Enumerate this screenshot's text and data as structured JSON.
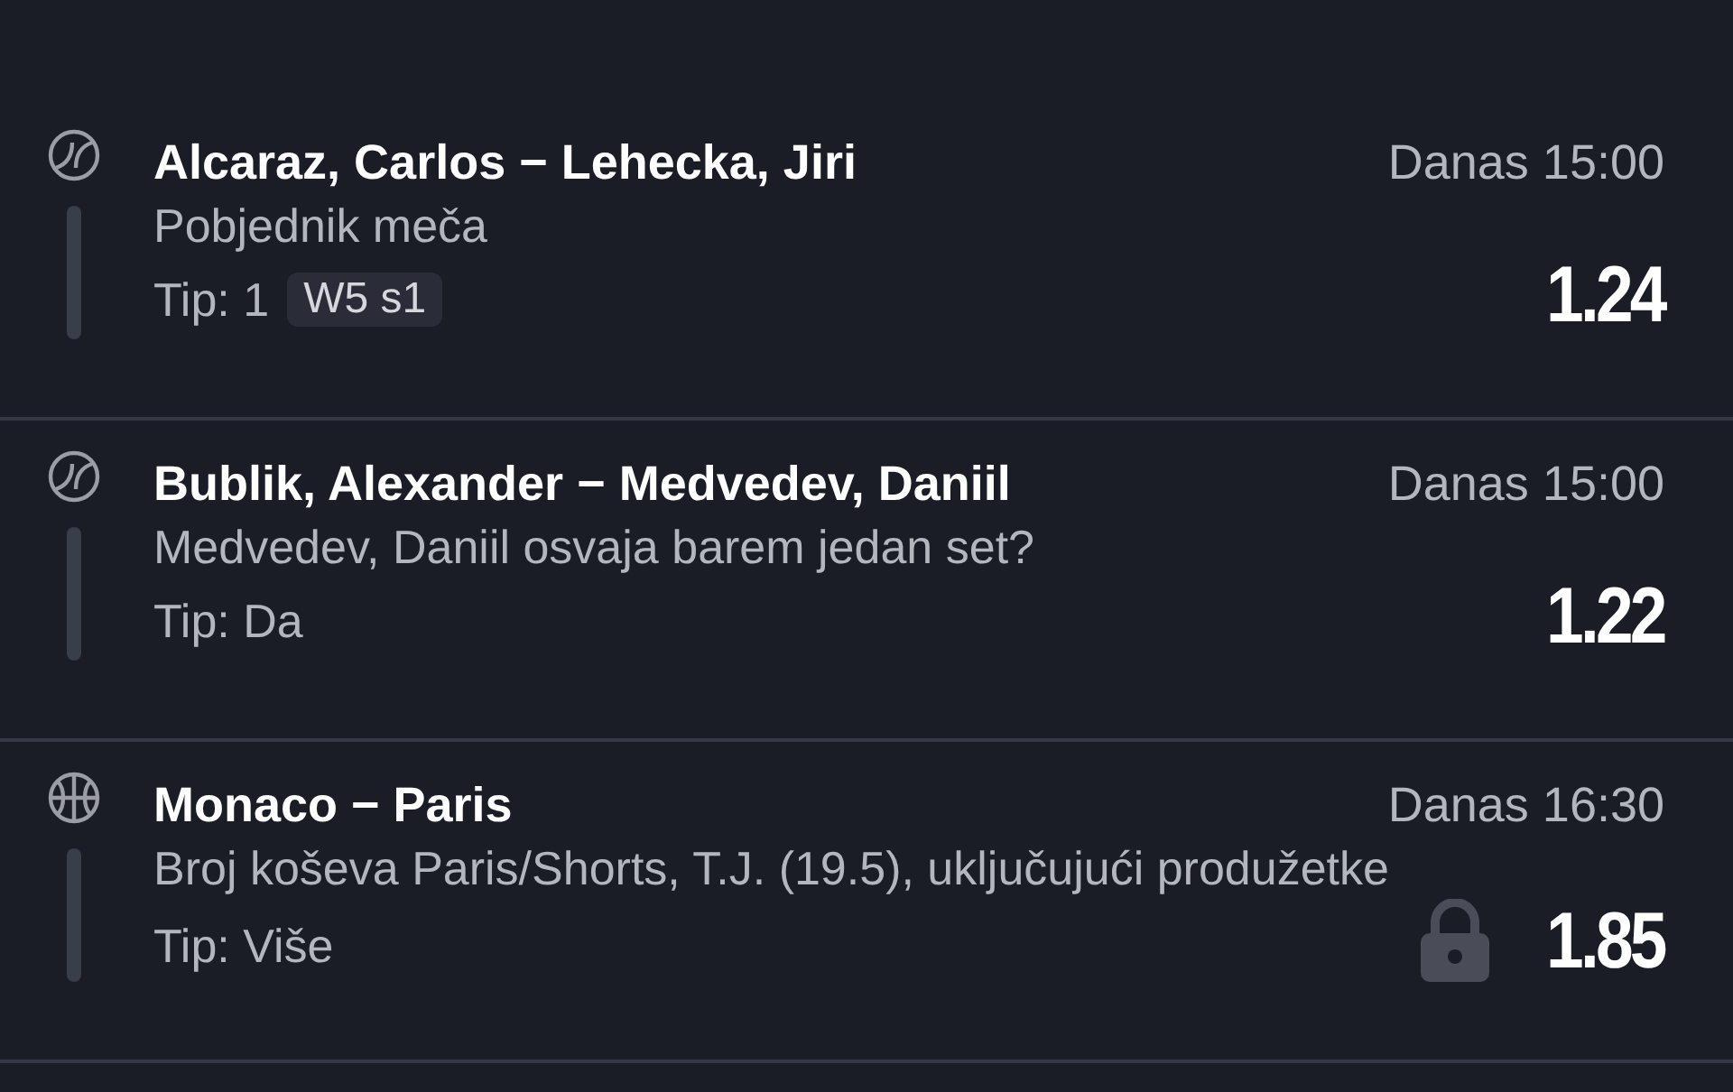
{
  "bets": [
    {
      "kind": "tennis",
      "match": "Alcaraz, Carlos − Lehecka, Jiri",
      "time": "Danas 15:00",
      "market": "Pobjednik meča",
      "tip": "Tip: 1",
      "tag": "W5 s1",
      "odds": "1.24",
      "locked": false
    },
    {
      "kind": "tennis",
      "match": "Bublik, Alexander − Medvedev, Daniil",
      "time": "Danas 15:00",
      "market": "Medvedev, Daniil osvaja barem jedan set?",
      "tip": "Tip: Da",
      "odds": "1.22",
      "locked": false
    },
    {
      "kind": "basketball",
      "match": "Monaco − Paris",
      "time": "Danas 16:30",
      "market": "Broj koševa Paris/Shorts, T.J. (19.5), uključujući produžetke",
      "tip": "Tip: Više",
      "odds": "1.85",
      "locked": true
    }
  ]
}
